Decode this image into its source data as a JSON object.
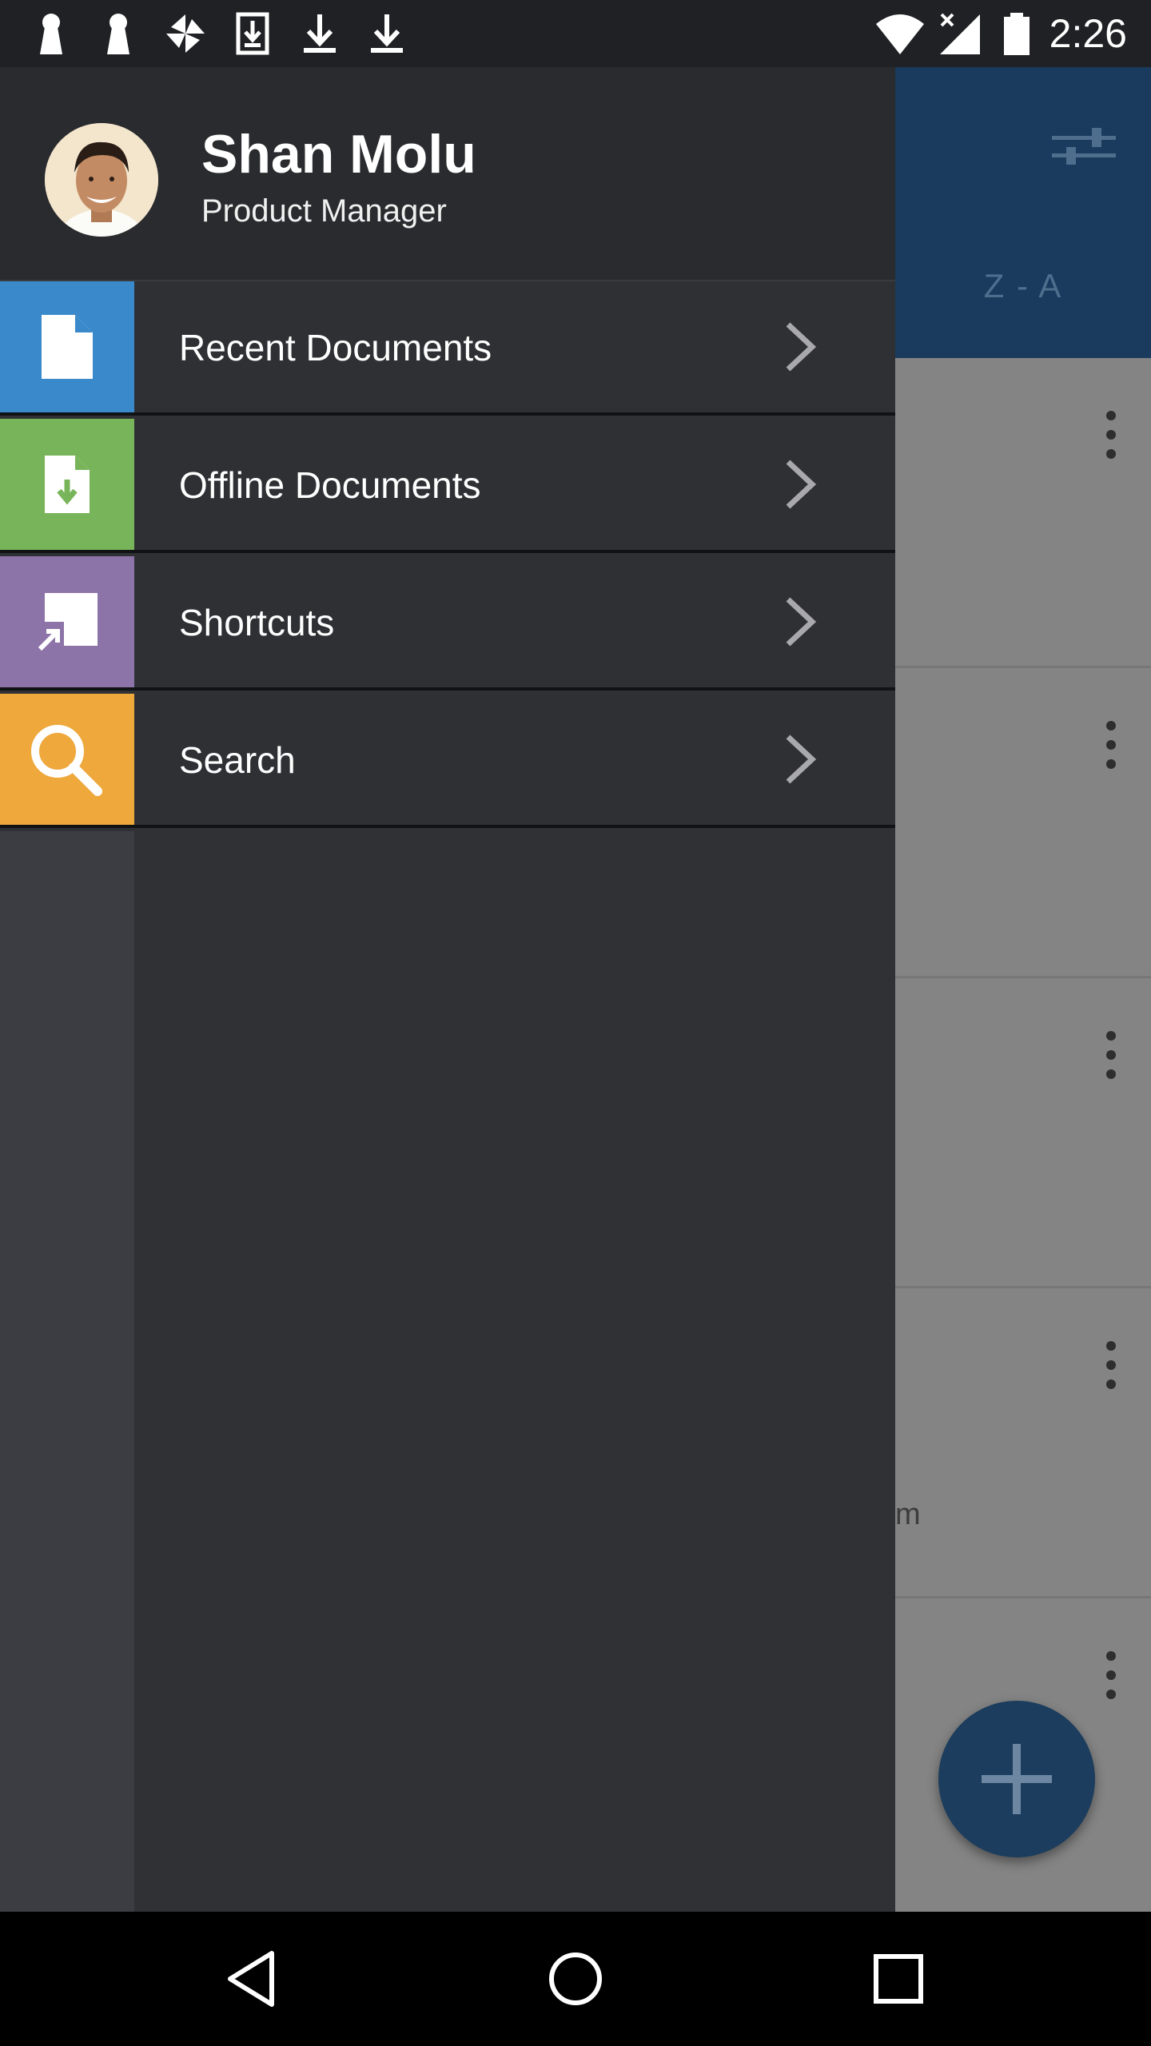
{
  "status_bar": {
    "time": "2:26",
    "left_icons": [
      "keyhole-icon",
      "keyhole-icon",
      "pinwheel-icon",
      "download-box-icon",
      "download-icon",
      "download-icon"
    ],
    "right_icons": [
      "wifi-icon",
      "signal-icon",
      "battery-icon"
    ]
  },
  "drawer": {
    "user": {
      "name": "Shan Molu",
      "role": "Product Manager"
    },
    "items": [
      {
        "label": "Recent Documents",
        "icon": "document-icon",
        "color": "#3a8acb"
      },
      {
        "label": "Offline Documents",
        "icon": "download-document-icon",
        "color": "#78b55a"
      },
      {
        "label": "Shortcuts",
        "icon": "shortcut-icon",
        "color": "#8d74a8"
      },
      {
        "label": "Search",
        "icon": "search-icon",
        "color": "#eea83c"
      }
    ]
  },
  "background_app": {
    "sort_label": "Z - A",
    "partial_text": "m",
    "toolbar_color": "#1a3b5d"
  },
  "nav_bar": {
    "buttons": [
      "back-icon",
      "home-icon",
      "recents-icon"
    ]
  }
}
